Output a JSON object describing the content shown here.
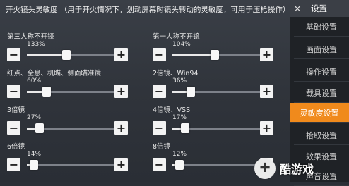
{
  "header": {
    "section_title": "开火镜头灵敏度 （用于开火情况下，划动屏幕时镜头转动的灵敏度，可用于压枪操作）"
  },
  "settings": [
    {
      "label": "第三人称不开镜",
      "value": "133%",
      "level_percent": 133
    },
    {
      "label": "第一人称不开镜",
      "value": "104%",
      "level_percent": 104
    },
    {
      "label": "红点、全息、机瞄、侧面瞄准镜",
      "value": "60%",
      "level_percent": 60
    },
    {
      "label": "2倍镜、Win94",
      "value": "36%",
      "level_percent": 36
    },
    {
      "label": "3倍镜",
      "value": "27%",
      "level_percent": 27
    },
    {
      "label": "4倍镜、VSS",
      "value": "17%",
      "level_percent": 17
    },
    {
      "label": "6倍镜",
      "value": "14%",
      "level_percent": 14
    },
    {
      "label": "8倍镜",
      "value": "12%",
      "level_percent": 12
    }
  ],
  "buttons": {
    "minus": "−",
    "plus": "+"
  },
  "sidebar": {
    "close_symbol": "×",
    "title": "设置",
    "items": [
      {
        "label": "基础设置"
      },
      {
        "label": "画面设置"
      },
      {
        "label": "操作设置"
      },
      {
        "label": "载具设置"
      },
      {
        "label": "灵敏度设置",
        "active": true
      },
      {
        "label": "拾取设置"
      },
      {
        "label": "效果设置"
      },
      {
        "label": "声音设置"
      }
    ]
  },
  "watermark": {
    "text": "酷游戏"
  },
  "colors": {
    "accent": "#f08a1c",
    "panel": "#30343b",
    "sidebar": "#1f2226"
  }
}
